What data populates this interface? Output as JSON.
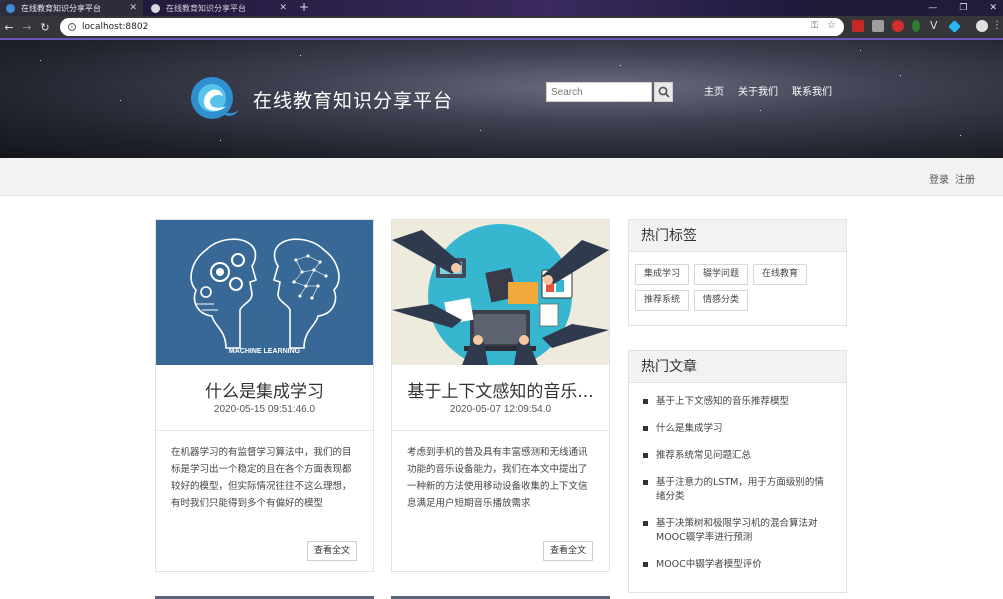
{
  "browser": {
    "tabs": [
      {
        "title": "在线教育知识分享平台",
        "active": true
      },
      {
        "title": "在线教育知识分享平台",
        "active": false
      }
    ],
    "url": "localhost:8802"
  },
  "header": {
    "site_title": "在线教育知识分享平台",
    "search_placeholder": "Search",
    "nav": [
      "主页",
      "关于我们",
      "联系我们"
    ]
  },
  "auth": {
    "login": "登录",
    "register": "注册"
  },
  "articles": [
    {
      "title": "什么是集成学习",
      "date": "2020-05-15 09:51:46.0",
      "image_caption": "MACHINE LEARNING",
      "excerpt": "在机器学习的有监督学习算法中，我们的目标是学习出一个稳定的且在各个方面表现都较好的模型，但实际情况往往不这么理想，有时我们只能得到多个有偏好的模型",
      "more_label": "查看全文"
    },
    {
      "title": "基于上下文感知的音乐...",
      "date": "2020-05-07 12:09:54.0",
      "excerpt": "考虑到手机的普及具有丰富感测和无线通讯功能的音乐设备能力，我们在本文中提出了一种新的方法使用移动设备收集的上下文信息满足用户短期音乐播放需求",
      "more_label": "查看全文"
    }
  ],
  "sidebar": {
    "hot_tags_title": "热门标签",
    "tags": [
      "集成学习",
      "辍学问题",
      "在线教育",
      "推荐系统",
      "情感分类"
    ],
    "hot_articles_title": "热门文章",
    "hot_articles": [
      "基于上下文感知的音乐推荐模型",
      "什么是集成学习",
      "推荐系统常见问题汇总",
      "基于注意力的LSTM，用于方面级别的情绪分类",
      "基于决策树和极限学习机的混合算法对MOOC辍学率进行预测",
      "MOOC中辍学者模型评价"
    ]
  },
  "colors": {
    "accent": "#6a54b8",
    "logo_blue": "#3b9fd4",
    "brand_cyan": "#33c1d6"
  }
}
